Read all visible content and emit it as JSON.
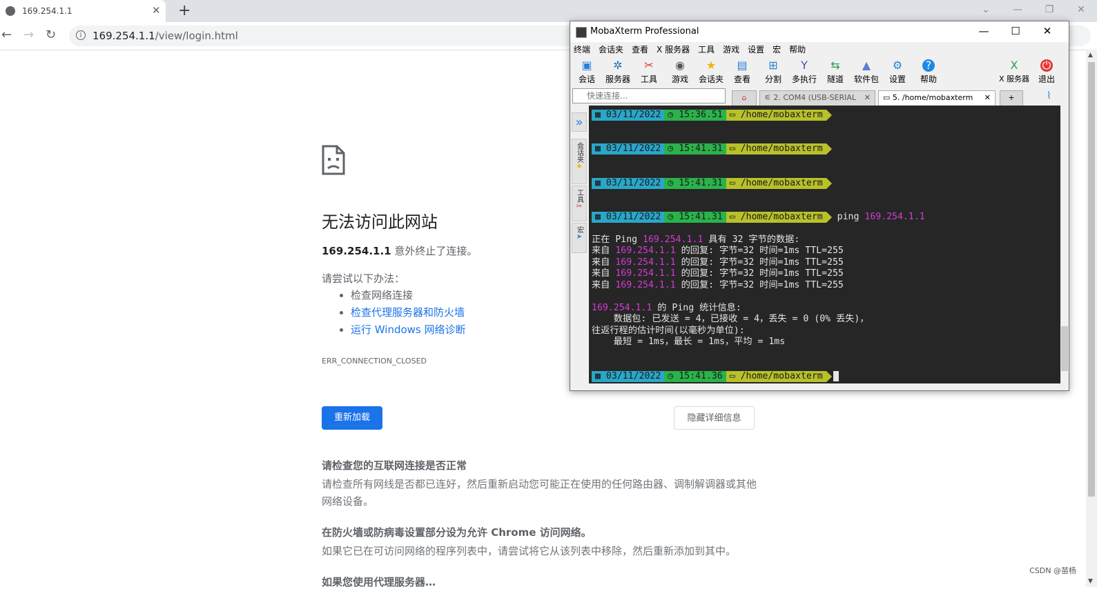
{
  "browser": {
    "tab_title": "169.254.1.1",
    "url_host": "169.254.1.1",
    "url_path": "/view/login.html"
  },
  "error_page": {
    "title": "无法访问此网站",
    "desc_host": "169.254.1.1",
    "desc_rest": " 意外终止了连接。",
    "try_title": "请尝试以下办法：",
    "suggestions": [
      "检查网络连接",
      "检查代理服务器和防火墙",
      "运行 Windows 网络诊断"
    ],
    "error_code": "ERR_CONNECTION_CLOSED",
    "reload_label": "重新加载",
    "details_label": "隐藏详细信息",
    "sections": [
      {
        "heading": "请检查您的互联网连接是否正常",
        "body": "请检查所有网线是否都已连好，然后重新启动您可能正在使用的任何路由器、调制解调器或其他网络设备。"
      },
      {
        "heading": "在防火墙或防病毒设置部分设为允许 Chrome 访问网络。",
        "body": "如果它已在可访问网络的程序列表中，请尝试将它从该列表中移除，然后重新添加到其中。"
      },
      {
        "heading": "如果您使用代理服务器…",
        "body": ""
      }
    ]
  },
  "watermark": "CSDN @苗杨",
  "mobaxterm": {
    "title": "MobaXterm Professional",
    "menu": [
      "终端",
      "会话夹",
      "查看",
      "X 服务器",
      "工具",
      "游戏",
      "设置",
      "宏",
      "帮助"
    ],
    "tools": [
      "会话",
      "服务器",
      "工具",
      "游戏",
      "会话夹",
      "查看",
      "分割",
      "多执行",
      "隧道",
      "软件包",
      "设置",
      "帮助"
    ],
    "tools_right": [
      "X 服务器",
      "退出"
    ],
    "quick_connect_placeholder": "快速连接...",
    "tabs": [
      "2. COM4  (USB-SERIAL",
      "5. /home/mobaxterm"
    ],
    "side_labels": [
      "会话夹",
      "工具",
      "宏"
    ],
    "accent_colors": {
      "date": "#2aa6c9",
      "time": "#2ab34b",
      "dir": "#b8c12a",
      "ip": "#d63bd6"
    },
    "prompts": [
      {
        "date": "03/11/2022",
        "time": "15:36.51",
        "dir": "/home/mobaxterm",
        "cmd": ""
      },
      {
        "date": "03/11/2022",
        "time": "15:41.31",
        "dir": "/home/mobaxterm",
        "cmd": ""
      },
      {
        "date": "03/11/2022",
        "time": "15:41.31",
        "dir": "/home/mobaxterm",
        "cmd": ""
      },
      {
        "date": "03/11/2022",
        "time": "15:41.31",
        "dir": "/home/mobaxterm",
        "cmd": "ping ",
        "cmd_ip": "169.254.1.1"
      }
    ],
    "output": {
      "l1a": "正在 Ping ",
      "ip": "169.254.1.1",
      "l1b": " 具有 32 字节的数据:",
      "reply_prefix": "来自 ",
      "reply_suffix": " 的回复: 字节=32 时间=1ms TTL=255",
      "stats_suffix": " 的 Ping 统计信息:",
      "stats_packets": "    数据包: 已发送 = 4，已接收 = 4，丢失 = 0 (0% 丢失)，",
      "stats_rtt_title": "往返行程的估计时间(以毫秒为单位):",
      "stats_rtt": "    最短 = 1ms，最长 = 1ms，平均 = 1ms"
    },
    "last_prompt": {
      "date": "03/11/2022",
      "time": "15:41.36",
      "dir": "/home/mobaxterm"
    }
  }
}
